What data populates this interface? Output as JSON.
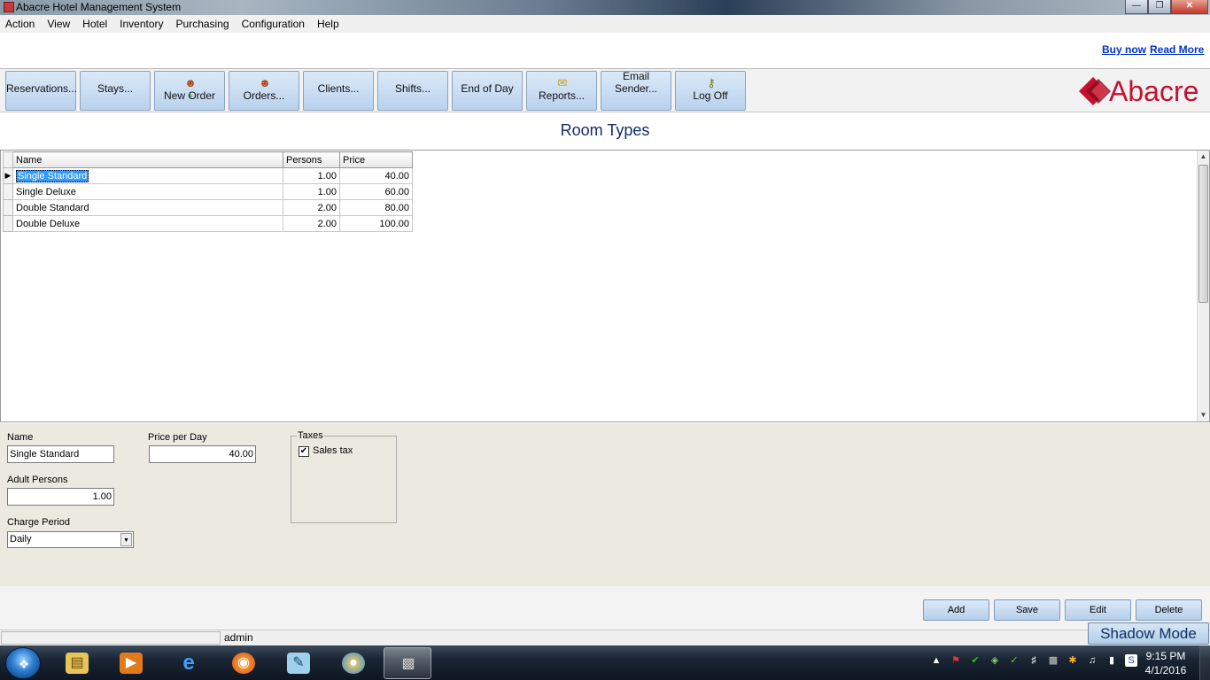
{
  "window": {
    "title": "Abacre Hotel Management System",
    "controls": [
      "minimize",
      "maximize",
      "close"
    ]
  },
  "menu": [
    "Action",
    "View",
    "Hotel",
    "Inventory",
    "Purchasing",
    "Configuration",
    "Help"
  ],
  "links": {
    "buy_now": "Buy now",
    "read_more": "Read More"
  },
  "toolbar": [
    {
      "label": "Reservations...",
      "icon": null
    },
    {
      "label": "Stays...",
      "icon": null
    },
    {
      "label": "New Order",
      "icon": "person-add-icon"
    },
    {
      "label": "Orders...",
      "icon": "people-icon"
    },
    {
      "label": "Clients...",
      "icon": null
    },
    {
      "label": "Shifts...",
      "icon": null
    },
    {
      "label": "End of Day",
      "icon": null
    },
    {
      "label": "Reports...",
      "icon": "report-icon"
    },
    {
      "label": "Email Sender...",
      "icon": null
    },
    {
      "label": "Log Off",
      "icon": "key-icon"
    }
  ],
  "logo_text": "Abacre",
  "page_title": "Room Types",
  "grid": {
    "columns": [
      "Name",
      "Persons",
      "Price"
    ],
    "rows": [
      {
        "name": "Single Standard",
        "persons": "1.00",
        "price": "40.00",
        "selected": true
      },
      {
        "name": "Single Deluxe",
        "persons": "1.00",
        "price": "60.00",
        "selected": false
      },
      {
        "name": "Double Standard",
        "persons": "2.00",
        "price": "80.00",
        "selected": false
      },
      {
        "name": "Double Deluxe",
        "persons": "2.00",
        "price": "100.00",
        "selected": false
      }
    ]
  },
  "form": {
    "name_label": "Name",
    "name_value": "Single Standard",
    "price_label": "Price per Day",
    "price_value": "40.00",
    "adult_label": "Adult Persons",
    "adult_value": "1.00",
    "charge_label": "Charge Period",
    "charge_value": "Daily",
    "taxes_label": "Taxes",
    "sales_tax_label": "Sales tax",
    "sales_tax_checked": true
  },
  "actions": {
    "add": "Add",
    "save": "Save",
    "edit": "Edit",
    "delete": "Delete"
  },
  "status": {
    "user": "admin",
    "shadow_mode": "Shadow Mode"
  },
  "taskbar": {
    "apps": [
      "start-button",
      "file-explorer-icon",
      "media-player-icon",
      "internet-explorer-icon",
      "firefox-icon",
      "notepad-icon",
      "globe-icon",
      "hotel-app-icon"
    ],
    "time": "9:15 PM",
    "date": "4/1/2016"
  },
  "colors": {
    "title_text": "#102a6a",
    "link": "#0033cc",
    "selection": "#3399ff",
    "logo_red": "#c8102e"
  }
}
